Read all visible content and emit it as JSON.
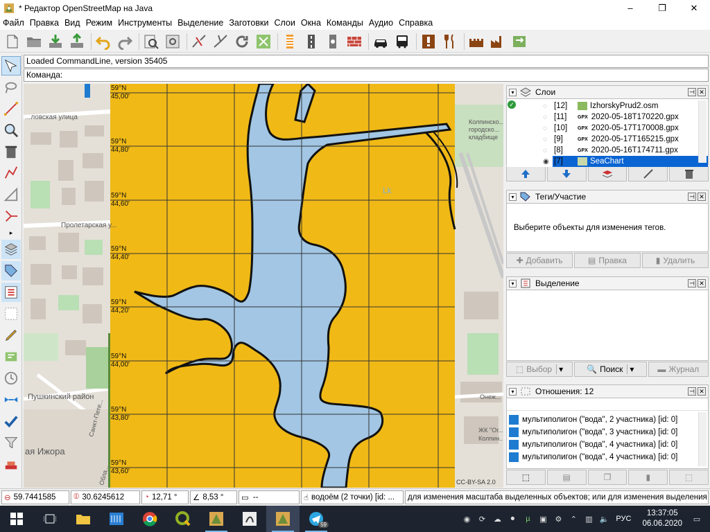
{
  "window": {
    "title": "* Редактор OpenStreetMap на Java",
    "minimize": "–",
    "maximize": "❐",
    "close": "✕"
  },
  "menu": [
    "Файл",
    "Правка",
    "Вид",
    "Режим",
    "Инструменты",
    "Выделение",
    "Заготовки",
    "Слои",
    "Окна",
    "Команды",
    "Аудио",
    "Справка"
  ],
  "commandline": {
    "status": "Loaded CommandLine, version 35405",
    "prompt": "Команда:"
  },
  "map": {
    "lat_labels": [
      {
        "deg": "59°N",
        "min": "45,00'"
      },
      {
        "deg": "59°N",
        "min": "44,80'"
      },
      {
        "deg": "59°N",
        "min": "44,60'"
      },
      {
        "deg": "59°N",
        "min": "44,40'"
      },
      {
        "deg": "59°N",
        "min": "44,20'"
      },
      {
        "deg": "59°N",
        "min": "44,00'"
      },
      {
        "deg": "59°N",
        "min": "43,80'"
      },
      {
        "deg": "59°N",
        "min": "43,60'"
      }
    ],
    "streets": {
      "a": "...ловская улица",
      "b": "Пролетарская у...",
      "c": "Пушкинский район",
      "d": "ая Ижора",
      "e": "Санкт-Пете...",
      "f": "Обла..."
    },
    "right_labels": {
      "cemetery1": "Колпинско...",
      "cemetery2": "городско...",
      "cemetery3": "кладбище",
      "onezh": "Онеж...",
      "zhk1": "ЖК \"Ог...",
      "zhk2": "Колпин..."
    },
    "attribution": "CC-BY-SA 2.0",
    "colors": {
      "chart": "#f0b916",
      "water": "#a2c6e4",
      "grid": "#333333"
    }
  },
  "layers": {
    "title": "Слои",
    "items": [
      {
        "num": "[12]",
        "type": "osm",
        "name": "IzhorskyPrud2.osm",
        "selected": false
      },
      {
        "num": "[11]",
        "type": "GPX",
        "name": "2020-05-18T170220.gpx",
        "selected": false
      },
      {
        "num": "[10]",
        "type": "GPX",
        "name": "2020-05-17T170008.gpx",
        "selected": false
      },
      {
        "num": "[9]",
        "type": "GPX",
        "name": "2020-05-17T165215.gpx",
        "selected": false
      },
      {
        "num": "[8]",
        "type": "GPX",
        "name": "2020-05-16T174711.gpx",
        "selected": false
      },
      {
        "num": "[7]",
        "type": "chart",
        "name": "SeaChart",
        "selected": true
      }
    ]
  },
  "tags": {
    "title": "Теги/Участие",
    "empty_text": "Выберите объекты для изменения тегов.",
    "add": "Добавить",
    "edit": "Правка",
    "delete": "Удалить"
  },
  "selection": {
    "title": "Выделение",
    "choose": "Выбор",
    "search": "Поиск",
    "journal": "Журнал"
  },
  "relations": {
    "title": "Отношения: 12",
    "items": [
      "мультиполигон (\"вода\", 2 участника) [id: 0]",
      "мультиполигон (\"вода\", 3 участника) [id: 0]",
      "мультиполигон (\"вода\", 4 участника) [id: 0]",
      "мультиполигон (\"вода\", 4 участника) [id: 0]"
    ]
  },
  "status": {
    "lat": "59.7441585",
    "lon": "30.6245612",
    "heading": "12,71 °",
    "angle": "8,53 °",
    "distance": "--",
    "object": "водоём (2 точки) [id: ...",
    "hint": "для изменения масштаба выделенных объектов; или для изменения выделения"
  },
  "taskbar": {
    "clock_time": "13:37:05",
    "clock_date": "06.06.2020",
    "lang": "РУС",
    "telegram_badge": "59"
  }
}
